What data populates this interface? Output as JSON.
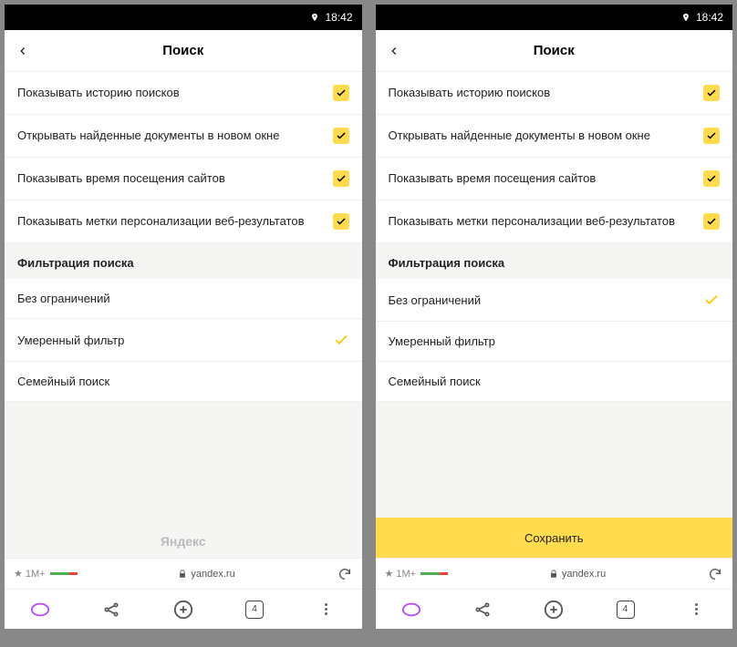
{
  "status": {
    "time": "18:42"
  },
  "header": {
    "title": "Поиск"
  },
  "options": [
    {
      "label": "Показывать историю поисков"
    },
    {
      "label": "Открывать найденные документы в новом окне"
    },
    {
      "label": "Показывать время посещения сайтов"
    },
    {
      "label": "Показывать метки персонализации веб-результатов"
    }
  ],
  "section": {
    "title": "Фильтрация поиска"
  },
  "filters": [
    {
      "label": "Без ограничений"
    },
    {
      "label": "Умеренный фильтр"
    },
    {
      "label": "Семейный поиск"
    }
  ],
  "left": {
    "selected": 1,
    "brand": "Яндекс"
  },
  "right": {
    "selected": 0,
    "save": "Сохранить"
  },
  "url": {
    "rating": "1M+",
    "domain": "yandex.ru"
  },
  "nav": {
    "tabs": "4"
  }
}
